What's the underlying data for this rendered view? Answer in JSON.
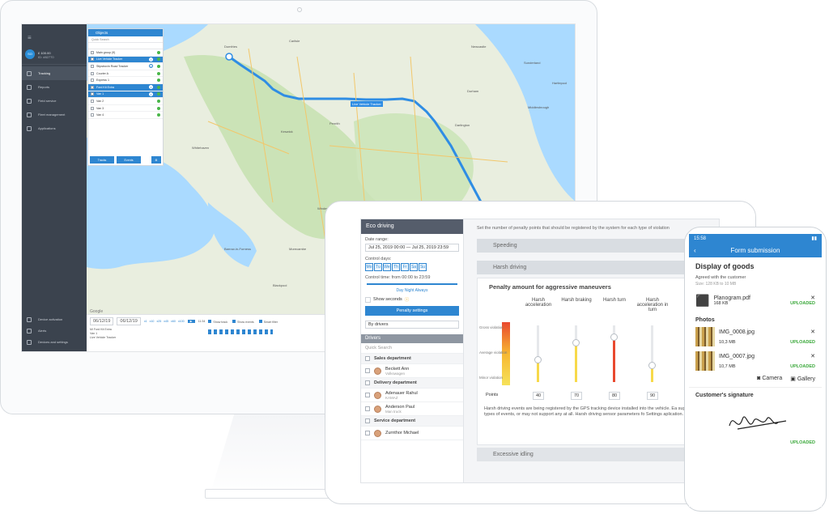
{
  "desktop": {
    "user": {
      "initials": "SO",
      "name": "£ 100.00",
      "id": "ID: #82770"
    },
    "nav": [
      "Tracking",
      "Reports",
      "Field service",
      "Fleet management",
      "Applications"
    ],
    "nav_bottom": [
      "Device activation",
      "Alerts",
      "Devices and settings"
    ],
    "objects": {
      "title": "Objects",
      "search": "Quick Search",
      "rows": [
        {
          "label": "Main group (9)",
          "sel": false,
          "num": ""
        },
        {
          "label": "Live Vehicle Tracker",
          "sel": true,
          "num": "1"
        },
        {
          "label": "Stipstrovin Road Tracker",
          "sel": false,
          "num": "2"
        },
        {
          "label": "Courier A",
          "sel": false,
          "num": ""
        },
        {
          "label": "Express 1",
          "sel": false,
          "num": ""
        },
        {
          "label": "Ford Kit Extra",
          "sel": true,
          "num": "3"
        },
        {
          "label": "Van 1",
          "sel": true,
          "num": "4"
        },
        {
          "label": "Van 2",
          "sel": false,
          "num": ""
        },
        {
          "label": "Van 3",
          "sel": false,
          "num": ""
        },
        {
          "label": "Van 4",
          "sel": false,
          "num": ""
        }
      ],
      "tracks": "Tracks",
      "events": "Events"
    },
    "map": {
      "places": [
        "Dumfries",
        "Carlisle",
        "Penrith",
        "Newcastle",
        "Sunderland",
        "Durham",
        "Hartlepool",
        "Middlesbrough",
        "Darlington",
        "Kendal",
        "Lancaster",
        "Blackpool",
        "Preston",
        "Morecambe",
        "Keswick",
        "Barrow-in-Furness",
        "Windermere",
        "Whitehaven"
      ],
      "marker": "Live Vehicle Tracker",
      "google": "Google"
    },
    "timeline": {
      "from": "06/12/19",
      "to": "06/12/19",
      "speeds": [
        "x1",
        "x10",
        "x25",
        "x45",
        "x60",
        "x100"
      ],
      "time": "11:34",
      "opts": [
        "Show track",
        "Show events",
        "Smart filter"
      ],
      "rows": [
        "Mi Ford Kit Extra",
        "Van 1",
        "Live Vehicle Tracker"
      ]
    }
  },
  "tablet": {
    "title": "Eco driving",
    "date_label": "Date range:",
    "date": "Jul 25, 2019 00:00 — Jul 25, 2019 23:59",
    "days_label": "Control days:",
    "days": [
      "Mo",
      "Tu",
      "We",
      "Th",
      "Fr",
      "Sa",
      "Su"
    ],
    "time_label": "Control time: from 00:00 to 23:59",
    "daynight": "Day Night Always",
    "show_seconds": "Show seconds",
    "penalty_btn": "Penalty settings",
    "by": "By drivers",
    "drivers_hdr": "Drivers",
    "drivers_search": "Quick Search",
    "drivers": [
      {
        "t": "g",
        "name": "Sales department"
      },
      {
        "t": "d",
        "name": "Beckett Ann",
        "sub": "Volkswagen"
      },
      {
        "t": "g",
        "name": "Delivery department"
      },
      {
        "t": "d",
        "name": "Adenauer Rahul",
        "sub": "KAMAZ"
      },
      {
        "t": "d",
        "name": "Anderson Paul",
        "sub": "Man truck"
      },
      {
        "t": "g",
        "name": "Service department"
      },
      {
        "t": "d",
        "name": "Zurnthor Michael",
        "sub": ""
      }
    ],
    "intro": "Set the number of penalty points that should be registered by the system for each type of violation",
    "speeding": "Speeding",
    "harsh": "Harsh driving",
    "penalty_title": "Penalty amount for aggressive maneuvers",
    "cols": [
      "Harsh acceleration",
      "Harsh braking",
      "Harsh turn",
      "Harsh acceleration in turn"
    ],
    "levels": [
      "Gross violation",
      "Average violation",
      "Minor violation"
    ],
    "points_label": "Points",
    "points": [
      "40",
      "70",
      "80",
      "90"
    ],
    "note": "Harsh driving events are being registered by the GPS tracking device installed into the vehicle. Ea support some types of events, or may not support any at all. Harsh driving sensor parameters fo Settings aplication.",
    "idling": "Excessive idling"
  },
  "phone": {
    "time": "15:58",
    "nav_title": "Form submission",
    "heading": "Display of goods",
    "agreed": "Agreed with the customer",
    "size_info": "Size: 128 KB to 10 MB",
    "file": {
      "name": "Planogram.pdf",
      "size": "168 KB",
      "status": "UPLOADED"
    },
    "photos_label": "Photos",
    "photos": [
      {
        "name": "IMG_0008.jpg",
        "size": "10,3 MB",
        "status": "UPLOADED"
      },
      {
        "name": "IMG_0007.jpg",
        "size": "10,7 MB",
        "status": "UPLOADED"
      }
    ],
    "camera": "Camera",
    "gallery": "Gallery",
    "signature_label": "Customer's signature",
    "sig_status": "UPLOADED"
  }
}
